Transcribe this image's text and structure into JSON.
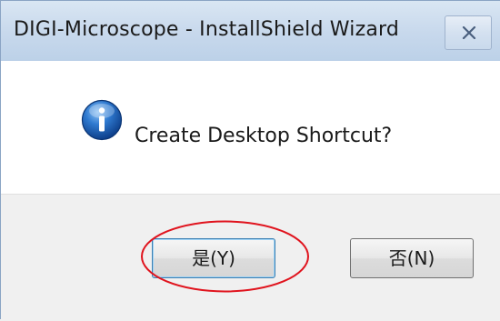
{
  "window": {
    "title": "DIGI-Microscope - InstallShield Wizard",
    "close_icon": "close-icon"
  },
  "dialog": {
    "icon": "info-icon",
    "message": "Create Desktop Shortcut?"
  },
  "buttons": {
    "yes_label": "是(Y)",
    "no_label": "否(N)"
  },
  "annotation": {
    "highlight_color": "#e0141e",
    "highlighted": "yes-button"
  },
  "colors": {
    "titlebar": "#c7d8ec",
    "content_bg": "#ffffff",
    "footer_bg": "#f0f0f0",
    "info_icon_blue": "#1b5fb4"
  }
}
